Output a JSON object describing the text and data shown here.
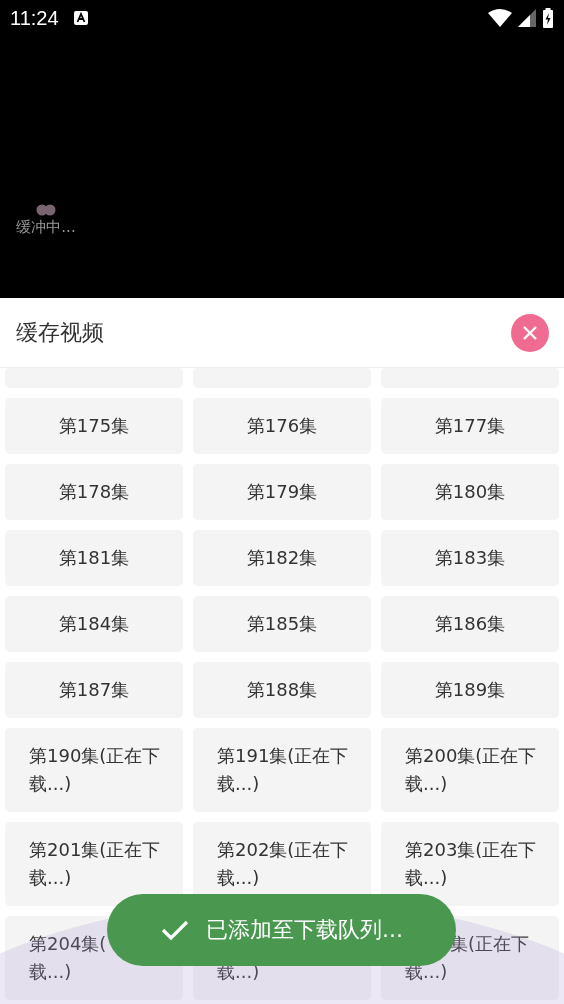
{
  "status_bar": {
    "time": "11:24"
  },
  "player": {
    "buffering_text": "缓冲中..."
  },
  "sheet": {
    "title": "缓存视频"
  },
  "episodes": [
    {
      "kind": "clipped"
    },
    {
      "kind": "clipped"
    },
    {
      "kind": "clipped"
    },
    {
      "kind": "plain",
      "label": "第175集"
    },
    {
      "kind": "plain",
      "label": "第176集"
    },
    {
      "kind": "plain",
      "label": "第177集"
    },
    {
      "kind": "plain",
      "label": "第178集"
    },
    {
      "kind": "plain",
      "label": "第179集"
    },
    {
      "kind": "plain",
      "label": "第180集"
    },
    {
      "kind": "plain",
      "label": "第181集"
    },
    {
      "kind": "plain",
      "label": "第182集"
    },
    {
      "kind": "plain",
      "label": "第183集"
    },
    {
      "kind": "plain",
      "label": "第184集"
    },
    {
      "kind": "plain",
      "label": "第185集"
    },
    {
      "kind": "plain",
      "label": "第186集"
    },
    {
      "kind": "plain",
      "label": "第187集"
    },
    {
      "kind": "plain",
      "label": "第188集"
    },
    {
      "kind": "plain",
      "label": "第189集"
    },
    {
      "kind": "downloading",
      "label": "第190集(正在下载...)"
    },
    {
      "kind": "downloading",
      "label": "第191集(正在下载...)"
    },
    {
      "kind": "downloading",
      "label": "第200集(正在下载...)"
    },
    {
      "kind": "downloading",
      "label": "第201集(正在下载...)"
    },
    {
      "kind": "downloading",
      "label": "第202集(正在下载...)"
    },
    {
      "kind": "downloading",
      "label": "第203集(正在下载...)"
    },
    {
      "kind": "covered",
      "top_line": "第204集(",
      "bottom_line": "载...)"
    },
    {
      "kind": "covered",
      "bottom_line": "载...)"
    },
    {
      "kind": "covered",
      "top_line": "集(正在下",
      "bottom_line": "载...)"
    }
  ],
  "toast": {
    "text": "已添加至下载队列..."
  }
}
